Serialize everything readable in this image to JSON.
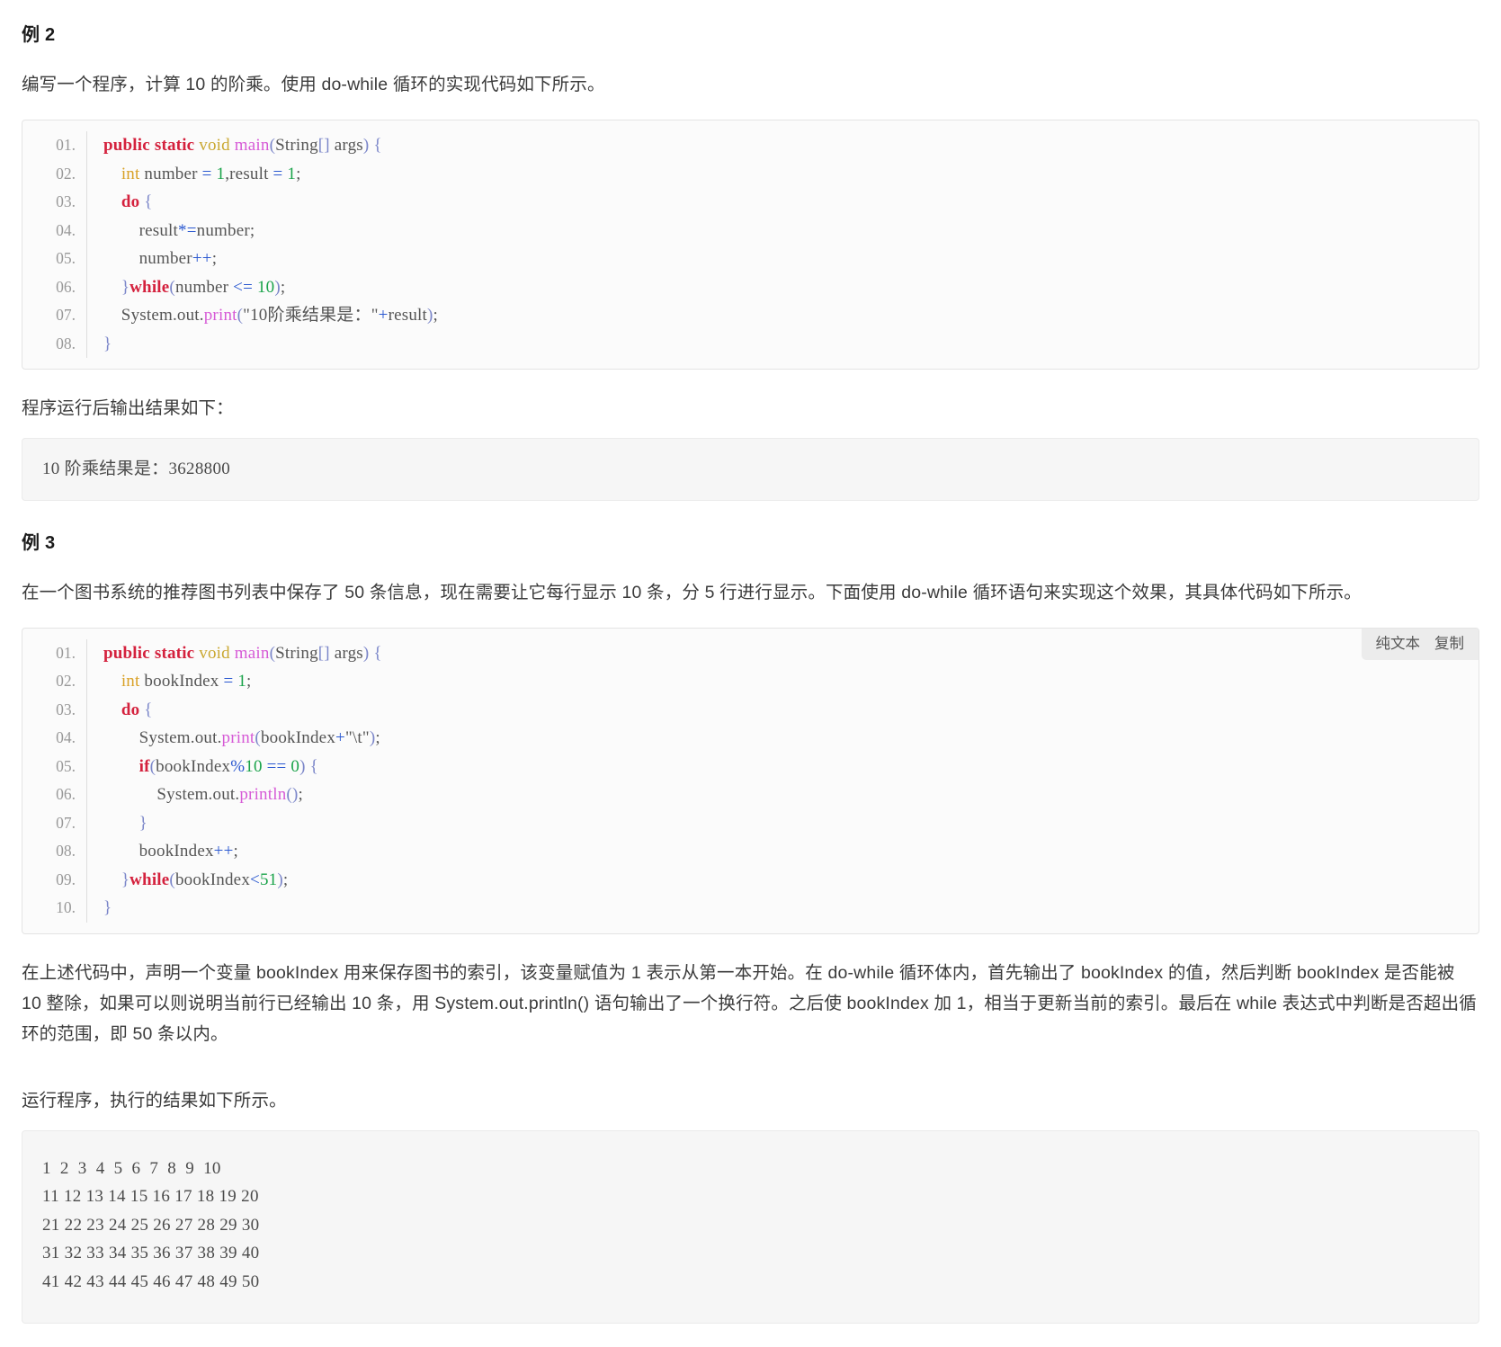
{
  "example2": {
    "heading": "例 2",
    "intro": "编写一个程序，计算 10 的阶乘。使用 do-while 循环的实现代码如下所示。",
    "code_lines": [
      {
        "no": "01.",
        "tokens": [
          {
            "t": "public ",
            "c": "kw"
          },
          {
            "t": "static ",
            "c": "kw"
          },
          {
            "t": "void ",
            "c": "void"
          },
          {
            "t": "main",
            "c": "fn"
          },
          {
            "t": "(",
            "c": "pun"
          },
          {
            "t": "String",
            "c": "plain"
          },
          {
            "t": "[]",
            "c": "pun"
          },
          {
            "t": " args",
            "c": "plain"
          },
          {
            "t": ")",
            "c": "pun"
          },
          {
            "t": " ",
            "c": "plain"
          },
          {
            "t": "{",
            "c": "pun"
          }
        ]
      },
      {
        "no": "02.",
        "tokens": [
          {
            "t": "    ",
            "c": "plain"
          },
          {
            "t": "int ",
            "c": "typ"
          },
          {
            "t": "number ",
            "c": "plain"
          },
          {
            "t": "=",
            "c": "op"
          },
          {
            "t": " ",
            "c": "plain"
          },
          {
            "t": "1",
            "c": "num"
          },
          {
            "t": ",result ",
            "c": "plain"
          },
          {
            "t": "=",
            "c": "op"
          },
          {
            "t": " ",
            "c": "plain"
          },
          {
            "t": "1",
            "c": "num"
          },
          {
            "t": ";",
            "c": "plain"
          }
        ]
      },
      {
        "no": "03.",
        "tokens": [
          {
            "t": "    ",
            "c": "plain"
          },
          {
            "t": "do",
            "c": "kw"
          },
          {
            "t": " ",
            "c": "plain"
          },
          {
            "t": "{",
            "c": "pun"
          }
        ]
      },
      {
        "no": "04.",
        "tokens": [
          {
            "t": "        result",
            "c": "plain"
          },
          {
            "t": "*=",
            "c": "op"
          },
          {
            "t": "number;",
            "c": "plain"
          }
        ]
      },
      {
        "no": "05.",
        "tokens": [
          {
            "t": "        number",
            "c": "plain"
          },
          {
            "t": "++",
            "c": "op"
          },
          {
            "t": ";",
            "c": "plain"
          }
        ]
      },
      {
        "no": "06.",
        "tokens": [
          {
            "t": "    ",
            "c": "plain"
          },
          {
            "t": "}",
            "c": "pun"
          },
          {
            "t": "while",
            "c": "kw"
          },
          {
            "t": "(",
            "c": "pun"
          },
          {
            "t": "number ",
            "c": "plain"
          },
          {
            "t": "<=",
            "c": "op"
          },
          {
            "t": " ",
            "c": "plain"
          },
          {
            "t": "10",
            "c": "num"
          },
          {
            "t": ")",
            "c": "pun"
          },
          {
            "t": ";",
            "c": "plain"
          }
        ]
      },
      {
        "no": "07.",
        "tokens": [
          {
            "t": "    System.out.",
            "c": "plain"
          },
          {
            "t": "print",
            "c": "fn"
          },
          {
            "t": "(",
            "c": "pun"
          },
          {
            "t": "\"10阶乘结果是：\"",
            "c": "str"
          },
          {
            "t": "+",
            "c": "op"
          },
          {
            "t": "result",
            "c": "plain"
          },
          {
            "t": ")",
            "c": "pun"
          },
          {
            "t": ";",
            "c": "plain"
          }
        ]
      },
      {
        "no": "08.",
        "tokens": [
          {
            "t": "}",
            "c": "pun"
          }
        ]
      }
    ],
    "output_caption": "程序运行后输出结果如下：",
    "output_text": "10 阶乘结果是：3628800"
  },
  "example3": {
    "heading": "例 3",
    "intro": "在一个图书系统的推荐图书列表中保存了 50 条信息，现在需要让它每行显示 10 条，分 5 行进行显示。下面使用 do-while 循环语句来实现这个效果，其具体代码如下所示。",
    "toolbar": {
      "plain_text_label": "纯文本",
      "copy_label": "复制"
    },
    "code_lines": [
      {
        "no": "01.",
        "tokens": [
          {
            "t": "public ",
            "c": "kw"
          },
          {
            "t": "static ",
            "c": "kw"
          },
          {
            "t": "void ",
            "c": "void"
          },
          {
            "t": "main",
            "c": "fn"
          },
          {
            "t": "(",
            "c": "pun"
          },
          {
            "t": "String",
            "c": "plain"
          },
          {
            "t": "[]",
            "c": "pun"
          },
          {
            "t": " args",
            "c": "plain"
          },
          {
            "t": ")",
            "c": "pun"
          },
          {
            "t": " ",
            "c": "plain"
          },
          {
            "t": "{",
            "c": "pun"
          }
        ]
      },
      {
        "no": "02.",
        "tokens": [
          {
            "t": "    ",
            "c": "plain"
          },
          {
            "t": "int ",
            "c": "typ"
          },
          {
            "t": "bookIndex ",
            "c": "plain"
          },
          {
            "t": "=",
            "c": "op"
          },
          {
            "t": " ",
            "c": "plain"
          },
          {
            "t": "1",
            "c": "num"
          },
          {
            "t": ";",
            "c": "plain"
          }
        ]
      },
      {
        "no": "03.",
        "tokens": [
          {
            "t": "    ",
            "c": "plain"
          },
          {
            "t": "do",
            "c": "kw"
          },
          {
            "t": " ",
            "c": "plain"
          },
          {
            "t": "{",
            "c": "pun"
          }
        ]
      },
      {
        "no": "04.",
        "tokens": [
          {
            "t": "        System.out.",
            "c": "plain"
          },
          {
            "t": "print",
            "c": "fn"
          },
          {
            "t": "(",
            "c": "pun"
          },
          {
            "t": "bookIndex",
            "c": "plain"
          },
          {
            "t": "+",
            "c": "op"
          },
          {
            "t": "\"\\t\"",
            "c": "str"
          },
          {
            "t": ")",
            "c": "pun"
          },
          {
            "t": ";",
            "c": "plain"
          }
        ]
      },
      {
        "no": "05.",
        "tokens": [
          {
            "t": "        ",
            "c": "plain"
          },
          {
            "t": "if",
            "c": "kw"
          },
          {
            "t": "(",
            "c": "pun"
          },
          {
            "t": "bookIndex",
            "c": "plain"
          },
          {
            "t": "%",
            "c": "op"
          },
          {
            "t": "10",
            "c": "num"
          },
          {
            "t": " ",
            "c": "plain"
          },
          {
            "t": "==",
            "c": "op"
          },
          {
            "t": " ",
            "c": "plain"
          },
          {
            "t": "0",
            "c": "num"
          },
          {
            "t": ")",
            "c": "pun"
          },
          {
            "t": " ",
            "c": "plain"
          },
          {
            "t": "{",
            "c": "pun"
          }
        ]
      },
      {
        "no": "06.",
        "tokens": [
          {
            "t": "            System.out.",
            "c": "plain"
          },
          {
            "t": "println",
            "c": "fn"
          },
          {
            "t": "()",
            "c": "pun"
          },
          {
            "t": ";",
            "c": "plain"
          }
        ]
      },
      {
        "no": "07.",
        "tokens": [
          {
            "t": "        ",
            "c": "plain"
          },
          {
            "t": "}",
            "c": "pun"
          }
        ]
      },
      {
        "no": "08.",
        "tokens": [
          {
            "t": "        bookIndex",
            "c": "plain"
          },
          {
            "t": "++",
            "c": "op"
          },
          {
            "t": ";",
            "c": "plain"
          }
        ]
      },
      {
        "no": "09.",
        "tokens": [
          {
            "t": "    ",
            "c": "plain"
          },
          {
            "t": "}",
            "c": "pun"
          },
          {
            "t": "while",
            "c": "kw"
          },
          {
            "t": "(",
            "c": "pun"
          },
          {
            "t": "bookIndex",
            "c": "plain"
          },
          {
            "t": "<",
            "c": "op"
          },
          {
            "t": "51",
            "c": "num"
          },
          {
            "t": ")",
            "c": "pun"
          },
          {
            "t": ";",
            "c": "plain"
          }
        ]
      },
      {
        "no": "10.",
        "tokens": [
          {
            "t": "}",
            "c": "pun"
          }
        ]
      }
    ],
    "explanation": "在上述代码中，声明一个变量 bookIndex 用来保存图书的索引，该变量赋值为 1 表示从第一本开始。在 do-while 循环体内，首先输出了 bookIndex 的值，然后判断 bookIndex 是否能被 10 整除，如果可以则说明当前行已经输出 10 条，用 System.out.println() 语句输出了一个换行符。之后使 bookIndex 加 1，相当于更新当前的索引。最后在 while 表达式中判断是否超出循环的范围，即 50 条以内。",
    "run_caption": "运行程序，执行的结果如下所示。",
    "output_rows": [
      "1  2  3  4  5  6  7  8  9  10",
      "11 12 13 14 15 16 17 18 19 20",
      "21 22 23 24 25 26 27 28 29 30",
      "31 32 33 34 35 36 37 38 39 40",
      "41 42 43 44 45 46 47 48 49 50"
    ]
  },
  "colors": {
    "keyword": "#d4213d",
    "type": "#d9a127",
    "function": "#d65ad6",
    "punctuation": "#7b86c9",
    "number": "#1aa34a",
    "operator": "#2a58d0",
    "text": "#555555",
    "code_bg": "#fbfbfb",
    "output_bg": "#f6f6f6",
    "toolbar_bg": "#ececec"
  }
}
